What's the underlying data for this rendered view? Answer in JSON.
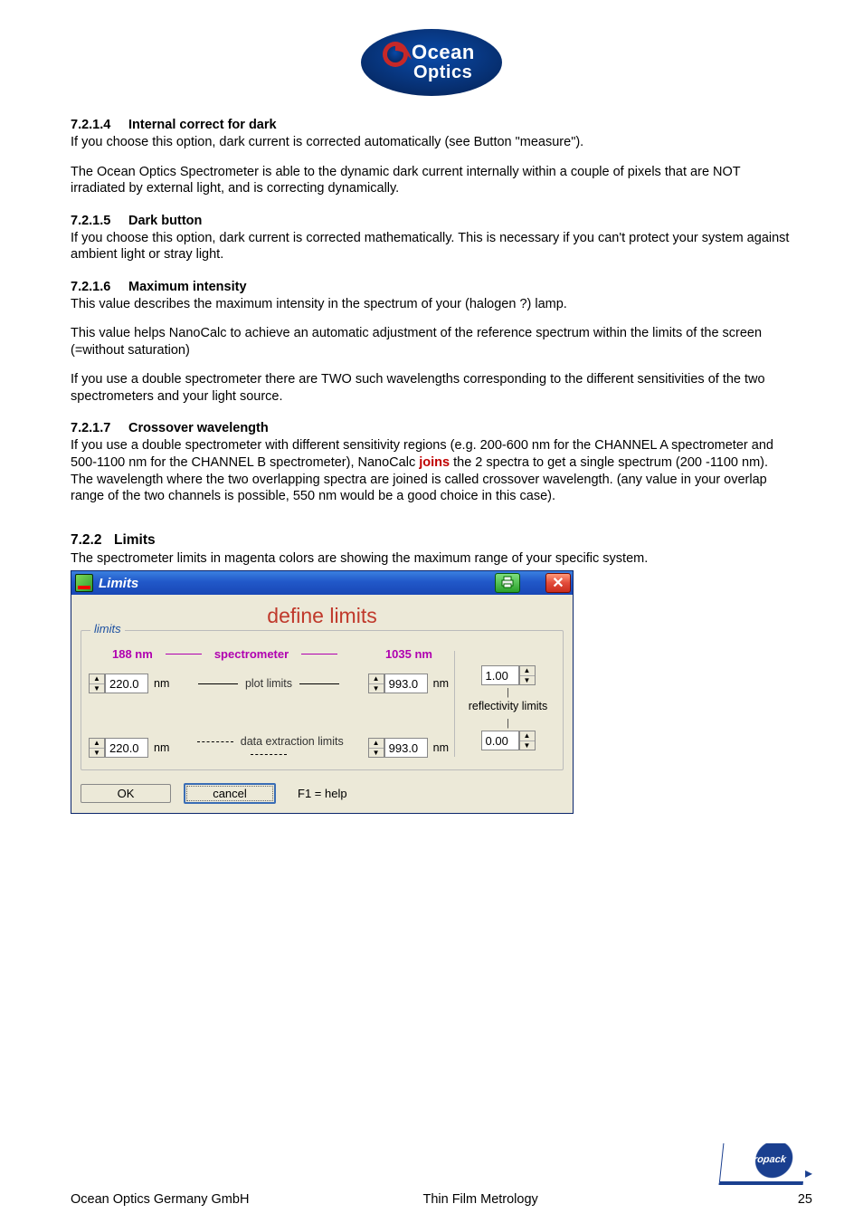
{
  "logo_top_text": "Ocean",
  "logo_bottom_text": "Optics",
  "sections": {
    "s1_num": "7.2.1.4",
    "s1_title": "Internal correct for dark",
    "s1_p1": "If you choose this option, dark current is corrected automatically (see Button \"measure\").",
    "s1_p2": "The Ocean Optics Spectrometer is able to the dynamic dark current internally within a couple of pixels that are NOT irradiated by external light, and is correcting dynamically.",
    "s2_num": "7.2.1.5",
    "s2_title": "Dark button",
    "s2_p1": "If you choose this option, dark current is corrected mathematically. This is necessary if you can't protect your system against ambient light or stray light.",
    "s3_num": "7.2.1.6",
    "s3_title": "Maximum intensity",
    "s3_p1": "This value describes the maximum intensity in the spectrum of your (halogen ?) lamp.",
    "s3_p2": "This value helps NanoCalc to achieve an automatic adjustment of the reference spectrum within the limits of the screen (=without saturation)",
    "s3_p3": "If you use a double spectrometer there are TWO such wavelengths corresponding to the different sensitivities of the two spectrometers and your light source.",
    "s4_num": "7.2.1.7",
    "s4_title": "Crossover wavelength",
    "s4_p1_a": "If you use a double spectrometer with different sensitivity regions (e.g. 200-600 nm for the CHANNEL A spectrometer and 500-1100 nm for the CHANNEL B spectrometer), NanoCalc ",
    "s4_p1_joins": "joins",
    "s4_p1_b": " the 2 spectra to get a single spectrum (200 -1100 nm). The wavelength where the two overlapping spectra are joined is called crossover wavelength. (any value in your overlap range of the two channels is possible, 550 nm would be a good choice in this case).",
    "limits_num": "7.2.2",
    "limits_title": "Limits",
    "limits_intro": "The spectrometer limits in magenta colors are showing the maximum range of your specific system."
  },
  "dialog": {
    "title": "Limits",
    "heading": "define limits",
    "group_legend": "limits",
    "spectrometer_label": "spectrometer",
    "spec_min": "188  nm",
    "spec_max": "1035  nm",
    "plot_limits_label": " plot limits ",
    "data_limits_label": " data extraction limits ",
    "plot_min": "220.0",
    "plot_max": "993.0",
    "data_min": "220.0",
    "data_max": "993.0",
    "unit_nm": "nm",
    "refl_label": "reflectivity limits",
    "refl_upper": "1.00",
    "refl_lower": "0.00",
    "ok_label": "OK",
    "cancel_label": "cancel",
    "help_hint": "F1  = help"
  },
  "footer": {
    "company": "Ocean Optics Germany GmbH",
    "center": "Thin Film Metrology",
    "brand": "Mikropack",
    "page": "25"
  }
}
